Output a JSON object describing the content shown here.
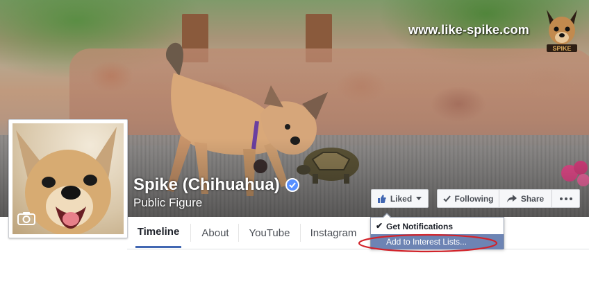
{
  "cover": {
    "website_text": "www.like-spike.com",
    "logo_text": "SPIKE"
  },
  "page": {
    "name": "Spike (Chihuahua)",
    "category": "Public Figure"
  },
  "actions": {
    "liked_label": "Liked",
    "following_label": "Following",
    "share_label": "Share"
  },
  "tabs": [
    {
      "label": "Timeline",
      "active": true
    },
    {
      "label": "About",
      "active": false
    },
    {
      "label": "YouTube",
      "active": false
    },
    {
      "label": "Instagram",
      "active": false
    }
  ],
  "dropdown": {
    "items": [
      {
        "label": "Get Notifications",
        "checked": true
      },
      {
        "label": "Add to Interest Lists...",
        "highlighted": true
      }
    ]
  },
  "colors": {
    "accent": "#4267b2",
    "menu_highlight": "#6d84b4",
    "annotation": "#d2232a",
    "verified": "#5890ff"
  }
}
